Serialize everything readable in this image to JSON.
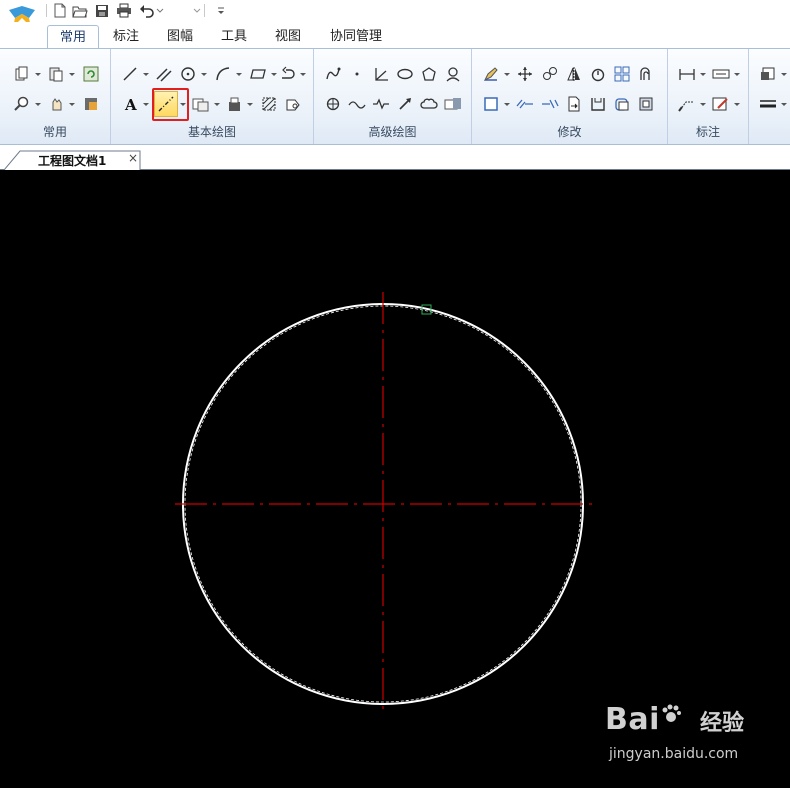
{
  "quick_access": {
    "icons": [
      "app-logo-icon",
      "new-file-icon",
      "open-folder-icon",
      "save-icon",
      "print-icon",
      "undo-icon",
      "customize-icon"
    ]
  },
  "ribbon": {
    "tabs": [
      {
        "label": "常用",
        "active": true
      },
      {
        "label": "标注",
        "active": false
      },
      {
        "label": "图幅",
        "active": false
      },
      {
        "label": "工具",
        "active": false
      },
      {
        "label": "视图",
        "active": false
      },
      {
        "label": "协同管理",
        "active": false
      }
    ],
    "groups": [
      {
        "label": "常用"
      },
      {
        "label": "基本绘图"
      },
      {
        "label": "高级绘图"
      },
      {
        "label": "修改"
      },
      {
        "label": "标注"
      }
    ],
    "highlighted_tool": "centerline-tool-icon"
  },
  "document": {
    "tab_label": "工程图文档1",
    "close_glyph": "×"
  },
  "canvas": {
    "background": "#000000",
    "circle_color": "#ffffff",
    "centerline_color": "#cc0000",
    "cursor_marker_color": "#2fae5a"
  },
  "watermark": {
    "brand": "Bai",
    "suffix": "经验",
    "url": "jingyan.baidu.com"
  },
  "colors": {
    "highlight_box": "#e02020",
    "ribbon_accent": "#1e3c6e"
  }
}
